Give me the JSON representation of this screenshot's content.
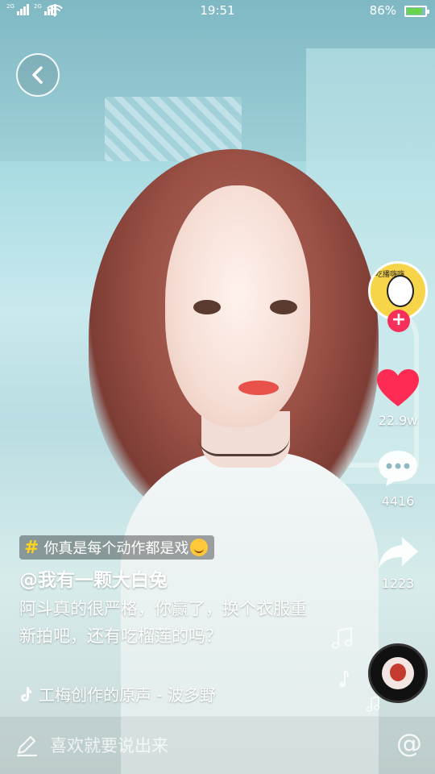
{
  "status_bar": {
    "sim1_label": "2G",
    "sim2_label": "2G",
    "time": "19:51",
    "battery_text": "86%",
    "battery_level": 0.86
  },
  "back_button": {
    "icon": "chevron-left-icon"
  },
  "creator": {
    "avatar_text": "吃播嗨嗨",
    "follow_symbol": "+"
  },
  "actions": {
    "like_count": "22.9w",
    "comment_count": "4416",
    "share_count": "1223"
  },
  "video": {
    "hashtag": "你真是每个动作都是戏",
    "hashtag_symbol": "#",
    "username": "@我有一颗大白兔",
    "caption": "阿斗真的很严格，你赢了，换个衣服重新拍吧，还有吃榴莲的吗？",
    "music": "工梅创作的原声 - 波多野"
  },
  "comment_bar": {
    "placeholder": "喜欢就要说出来",
    "at_symbol": "@"
  },
  "colors": {
    "like": "#fe2c55",
    "follow": "#f6305a",
    "hashtag": "#ffd21c",
    "battery": "#6bd44f"
  }
}
